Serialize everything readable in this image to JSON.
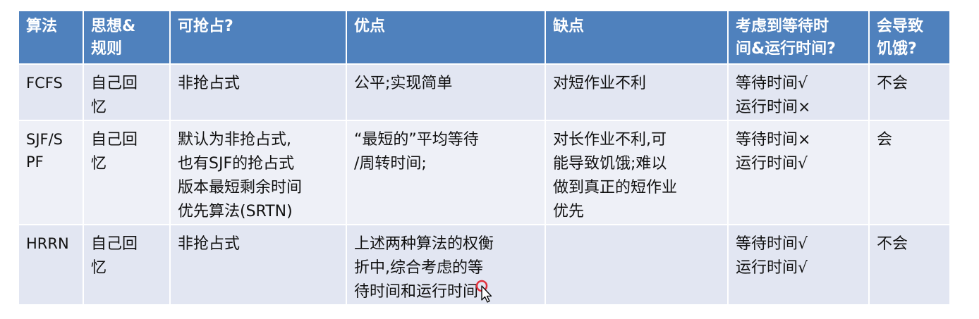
{
  "table": {
    "headers": [
      "算法",
      "思想&\n规则",
      "可抢占?",
      "优点",
      "缺点",
      "考虑到等待时\n间&运行时间?",
      "会导致\n饥饿?"
    ],
    "rows": [
      {
        "algorithm": "FCFS",
        "idea": "自己回\n忆",
        "preemptive": "非抢占式",
        "pros": "公平;实现简单",
        "cons": "对短作业不利",
        "wait_run": "等待时间√\n运行时间×",
        "starvation": "不会"
      },
      {
        "algorithm": "SJF/S\nPF",
        "idea": "自己回\n忆",
        "preemptive": "默认为非抢占式,\n也有SJF的抢占式\n版本最短剩余时间\n优先算法(SRTN)",
        "pros": "“最短的”平均等待\n/周转时间;",
        "cons": "对长作业不利,可\n能导致饥饿;难以\n做到真正的短作业\n优先",
        "wait_run": "等待时间×\n运行时间√",
        "starvation": "会"
      },
      {
        "algorithm": "HRRN",
        "idea": "自己回\n忆",
        "preemptive": "非抢占式",
        "pros": "上述两种算法的权衡\n折中,综合考虑的等\n待时间和运行时间",
        "cons": "",
        "wait_run": "等待时间√\n运行时间√",
        "starvation": "不会"
      }
    ]
  },
  "colors": {
    "header_bg": "#4f81bd",
    "row_odd_bg": "#e2e6f2",
    "row_even_bg": "#eef0f7"
  },
  "icons": {
    "cursor": "mouse-pointer-icon"
  }
}
